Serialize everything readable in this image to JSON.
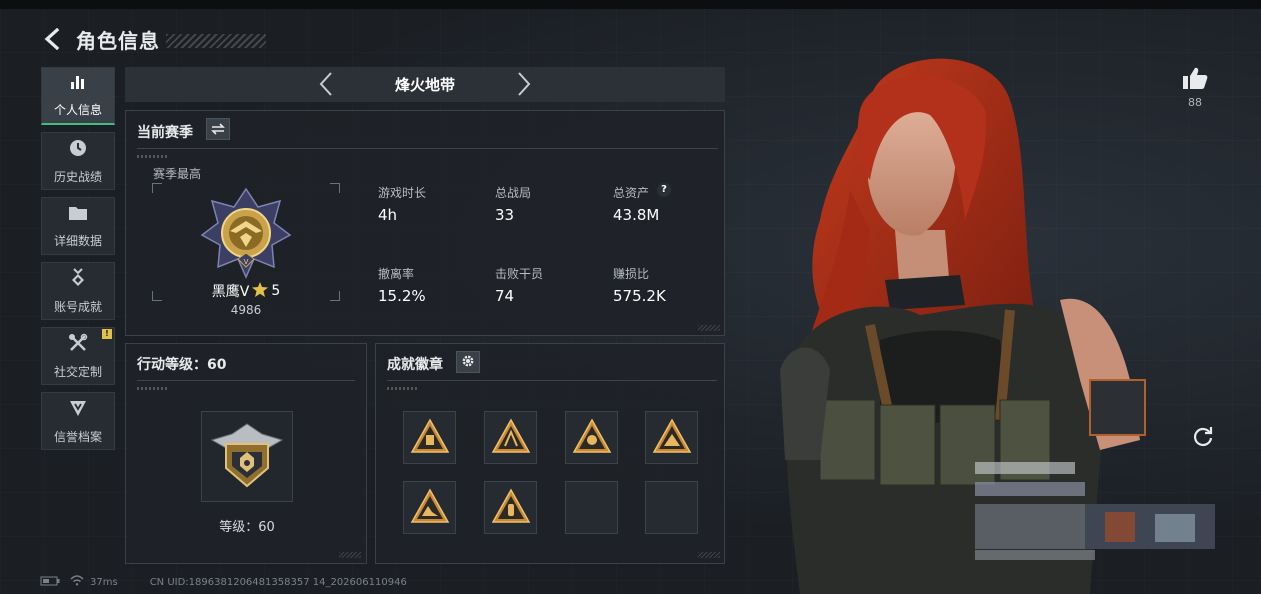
{
  "header": {
    "title": "角色信息"
  },
  "sidebar": {
    "items": [
      {
        "label": "个人信息",
        "icon": "bar-chart-icon",
        "active": true
      },
      {
        "label": "历史战绩",
        "icon": "clock-icon",
        "active": false
      },
      {
        "label": "详细数据",
        "icon": "folder-icon",
        "active": false
      },
      {
        "label": "账号成就",
        "icon": "medal-icon",
        "active": false
      },
      {
        "label": "社交定制",
        "icon": "tools-icon",
        "active": false,
        "badge": "!"
      },
      {
        "label": "信誉档案",
        "icon": "shield-icon",
        "active": false
      }
    ]
  },
  "season_bar": {
    "name": "烽火地带"
  },
  "current_season": {
    "title": "当前赛季",
    "best_label": "赛季最高",
    "rank_name": "黑鹰V",
    "rank_stars": "5",
    "rank_points": "4986",
    "stats": [
      {
        "label": "游戏时长",
        "value": "4h"
      },
      {
        "label": "总战局",
        "value": "33"
      },
      {
        "label": "总资产",
        "value": "43.8M",
        "help": "?"
      },
      {
        "label": "撤离率",
        "value": "15.2%"
      },
      {
        "label": "击败干员",
        "value": "74"
      },
      {
        "label": "赚损比",
        "value": "575.2K"
      }
    ]
  },
  "action_level": {
    "title": "行动等级：60",
    "level_text": "等级：60"
  },
  "achievements": {
    "title": "成就徽章",
    "slots": 8,
    "filled": 6
  },
  "like": {
    "count": "88"
  },
  "footer": {
    "ping": "37ms",
    "uid": "CN UID:1896381206481358357 14_202606110946"
  },
  "colors": {
    "accent": "#3fbf7f",
    "gold": "#c9a24a",
    "badge": "#e2c14a"
  }
}
